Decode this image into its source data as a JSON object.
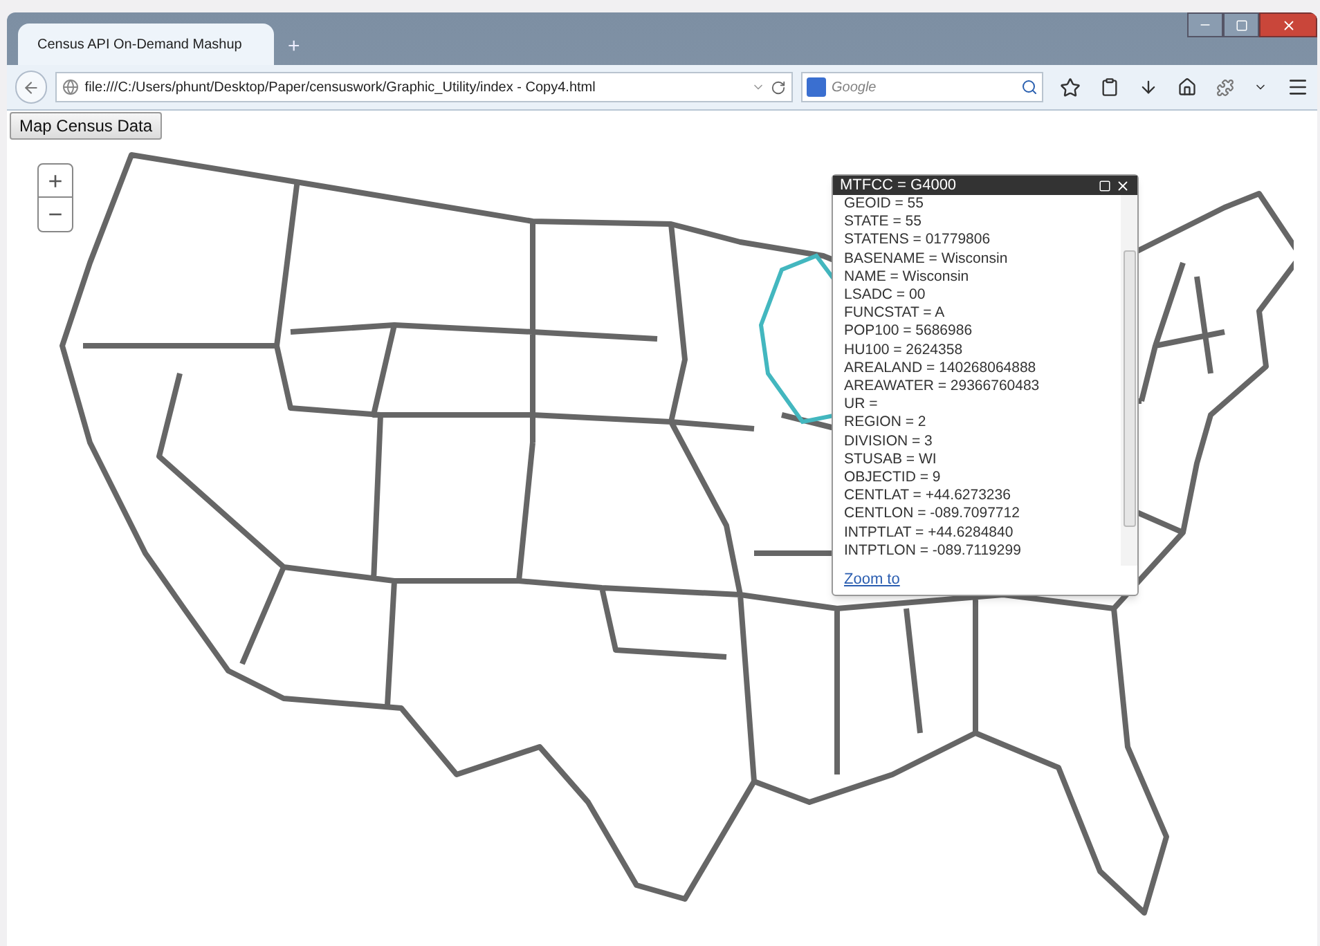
{
  "tabs": [
    {
      "label": "Census API On-Demand Mashup",
      "selected": true
    }
  ],
  "new_tab": "+",
  "address_bar": {
    "value": "file:///C:/Users/phunt/Desktop/Paper/censuswork/Graphic_Utility/index - Copy4.html"
  },
  "search": {
    "placeholder": "Google"
  },
  "page": {
    "button": "Map Census Data",
    "zoom_in": "+",
    "zoom_out": "−",
    "popup": {
      "title": "MTFCC = G4000",
      "lines": [
        "GEOID = 55",
        "STATE = 55",
        "STATENS = 01779806",
        "BASENAME = Wisconsin",
        "NAME = Wisconsin",
        "LSADC = 00",
        "FUNCSTAT = A",
        "POP100 = 5686986",
        "HU100 = 2624358",
        "AREALAND = 140268064888",
        "AREAWATER = 29366760483",
        "UR =",
        "REGION = 2",
        "DIVISION = 3",
        "STUSAB = WI",
        "OBJECTID = 9",
        "CENTLAT = +44.6273236",
        "CENTLON = -089.7097712",
        "INTPTLAT = +44.6284840",
        "INTPTLON = -089.7119299"
      ],
      "link": "Zoom to"
    }
  }
}
